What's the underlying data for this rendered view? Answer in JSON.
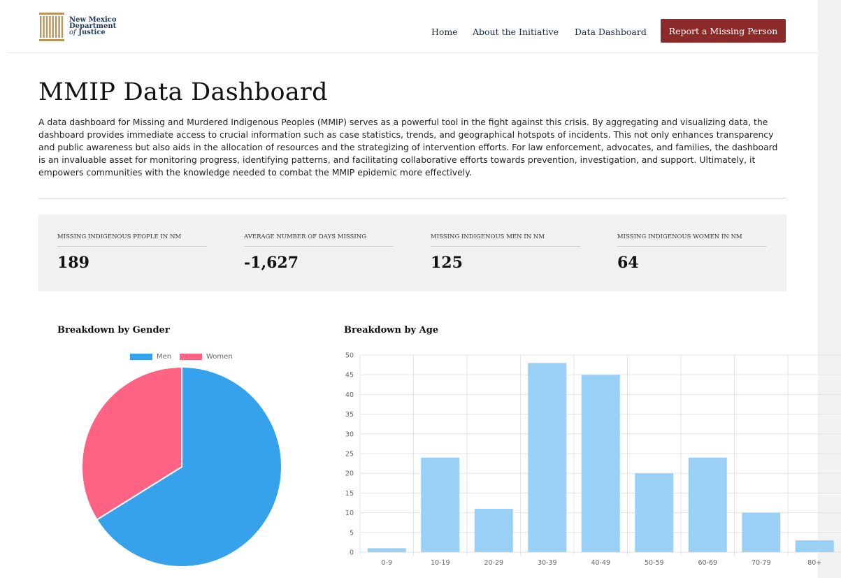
{
  "header": {
    "logo": {
      "line1": "New Mexico",
      "line2": "Department",
      "line3_prefix": "of",
      "line3": "Justice"
    },
    "nav": [
      {
        "label": "Home"
      },
      {
        "label": "About the Initiative"
      },
      {
        "label": "Data Dashboard"
      }
    ],
    "cta_label": "Report a Missing Person",
    "colors": {
      "cta": "#8c2a2a",
      "logo_text": "#233a63",
      "logo_gold": "#b8955a"
    }
  },
  "page": {
    "title": "MMIP Data Dashboard",
    "intro": "A data dashboard for Missing and Murdered Indigenous Peoples (MMIP) serves as a powerful tool in the fight against this crisis. By aggregating and visualizing data, the dashboard provides immediate access to crucial information such as case statistics, trends, and geographical hotspots of incidents. This not only enhances transparency and public awareness but also aids in the allocation of resources and the strategizing of intervention efforts. For law enforcement, advocates, and families, the dashboard is an invaluable asset for monitoring progress, identifying patterns, and facilitating collaborative efforts towards prevention, investigation, and support. Ultimately, it empowers communities with the knowledge needed to combat the MMIP epidemic more effectively."
  },
  "stats": [
    {
      "label": "MISSING INDIGENOUS PEOPLE IN NM",
      "value": "189"
    },
    {
      "label": "AVERAGE NUMBER OF DAYS MISSING",
      "value": "-1,627"
    },
    {
      "label": "MISSING INDIGENOUS MEN IN NM",
      "value": "125"
    },
    {
      "label": "MISSING INDIGENOUS WOMEN IN NM",
      "value": "64"
    }
  ],
  "chart_data": [
    {
      "type": "pie",
      "title": "Breakdown by Gender",
      "categories": [
        "Men",
        "Women"
      ],
      "values": [
        125,
        64
      ],
      "colors": [
        "#36a2eb",
        "#ff6384"
      ],
      "legend": "top"
    },
    {
      "type": "bar",
      "title": "Breakdown by Age",
      "categories": [
        "0-9",
        "10-19",
        "20-29",
        "30-39",
        "40-49",
        "50-59",
        "60-69",
        "70-79",
        "80+"
      ],
      "values": [
        1,
        24,
        11,
        48,
        45,
        20,
        24,
        10,
        3
      ],
      "ylim": [
        0,
        50
      ],
      "yticks": [
        0,
        5,
        10,
        15,
        20,
        25,
        30,
        35,
        40,
        45,
        50
      ],
      "grid": true,
      "color": "#9ad0f5"
    }
  ]
}
